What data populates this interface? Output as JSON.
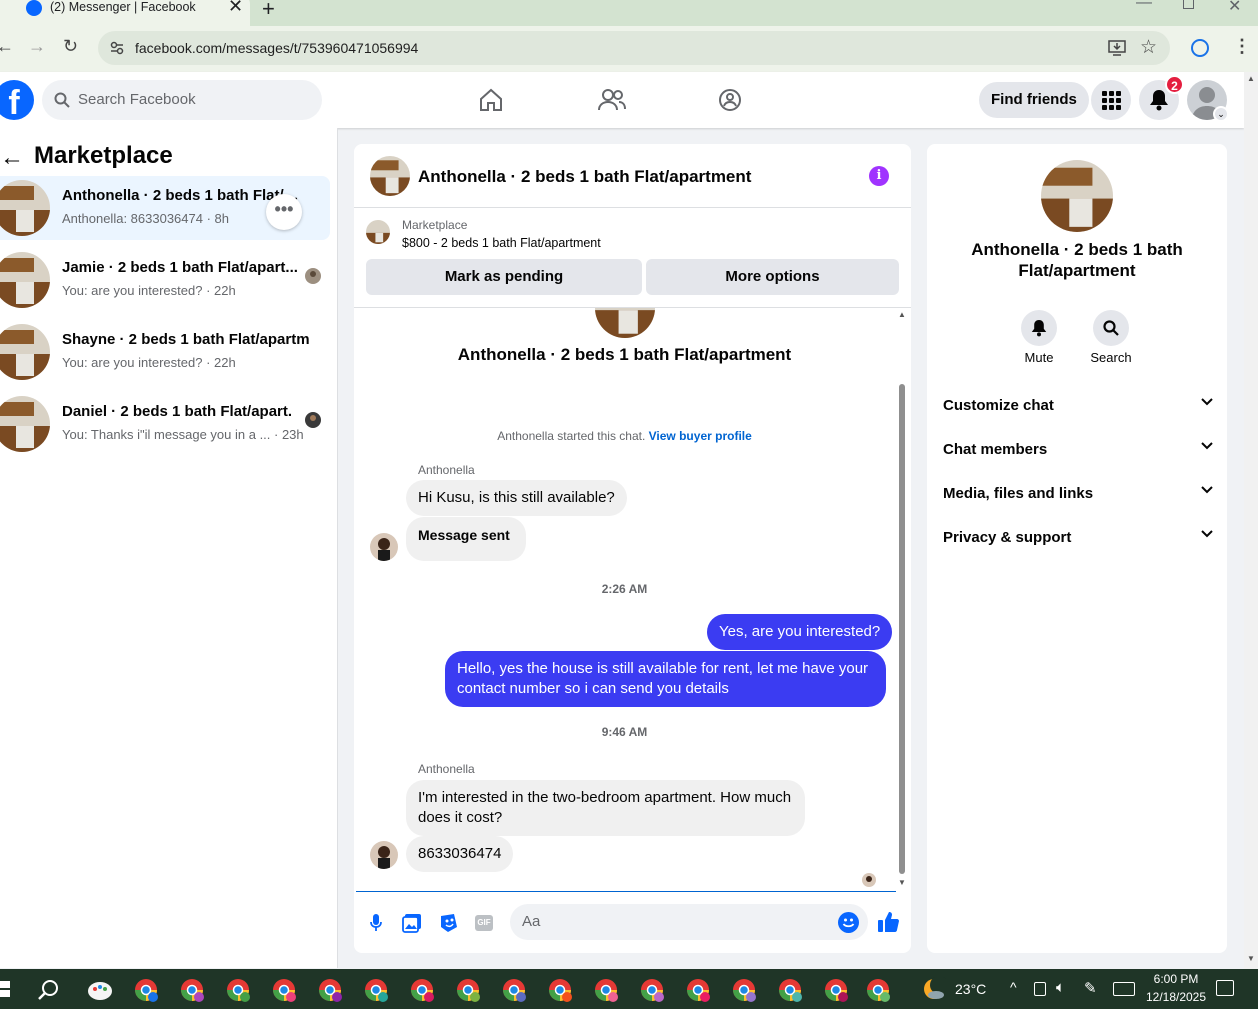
{
  "browser": {
    "tab_title": "(2) Messenger | Facebook",
    "url": "facebook.com/messages/t/753960471056994"
  },
  "header": {
    "search_placeholder": "Search Facebook",
    "find_friends": "Find friends",
    "notification_count": "2"
  },
  "sidebar": {
    "title": "Marketplace",
    "conversations": [
      {
        "name": "Anthonella · 2 beds 1 bath Flat/…",
        "preview": "Anthonella: 8633036474 · 8h"
      },
      {
        "name": "Jamie · 2 beds 1 bath Flat/apart...",
        "preview": "You: are you interested? · 22h"
      },
      {
        "name": "Shayne · 2 beds 1 bath Flat/apartm...",
        "preview": "You: are you interested? · 22h"
      },
      {
        "name": "Daniel · 2 beds 1 bath Flat/apart...",
        "preview": "You: Thanks i\"il message you in a ... · 23h"
      }
    ]
  },
  "chat": {
    "title": "Anthonella · 2 beds 1 bath Flat/apartment",
    "listing_source": "Marketplace",
    "listing_price": "$800 - 2 beds 1 bath Flat/apartment",
    "mark_pending": "Mark as pending",
    "more_options": "More options",
    "intro_name": "Anthonella · 2 beds 1 bath Flat/apartment",
    "started_text": "Anthonella started this chat.",
    "view_buyer": "View buyer profile",
    "sender1": "Anthonella",
    "msg1": "Hi Kusu, is this still available?",
    "msg2": "Message sent",
    "time1": "2:26 AM",
    "msg3": "Yes, are you interested?",
    "msg4": "Hello, yes the house is still available for rent, let me have your contact number so i can send you details",
    "time2": "9:46 AM",
    "sender2": "Anthonella",
    "msg5": "I'm interested in the two-bedroom apartment. How much does it cost?",
    "msg6": "8633036474",
    "composer_placeholder": "Aa"
  },
  "details": {
    "name": "Anthonella · 2 beds 1 bath Flat/apartment",
    "mute": "Mute",
    "search": "Search",
    "sections": [
      "Customize chat",
      "Chat members",
      "Media, files and links",
      "Privacy & support"
    ]
  },
  "taskbar": {
    "temperature": "23°C",
    "time": "6:00 PM",
    "date": "12/18/2025"
  },
  "colors": {
    "fb_blue": "#0866ff",
    "outgoing_bubble": "#3b3cf2",
    "badge_red": "#e41e3f",
    "info_purple": "#a033ff"
  }
}
